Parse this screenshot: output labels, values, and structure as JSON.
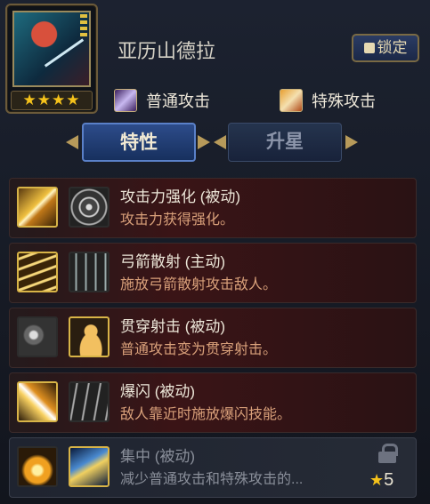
{
  "hero": {
    "name": "亚历山德拉",
    "stars": "★★★★",
    "lock_label": "锁定"
  },
  "attacks": [
    {
      "label": "普通攻击",
      "icon": "feather-icon"
    },
    {
      "label": "特殊攻击",
      "icon": "slash-icon"
    }
  ],
  "tabs": [
    {
      "label": "特性",
      "active": true
    },
    {
      "label": "升星",
      "active": false
    }
  ],
  "skills": [
    {
      "title": "攻击力强化 (被动)",
      "desc": "攻击力获得强化。",
      "locked": false,
      "icons": [
        "swords-icon",
        "target-icon"
      ],
      "active_icon": 0
    },
    {
      "title": "弓箭散射 (主动)",
      "desc": "施放弓箭散射攻击敌人。",
      "locked": false,
      "icons": [
        "arrows-icon",
        "arrow-rain-icon"
      ],
      "active_icon": 0
    },
    {
      "title": "贯穿射击 (被动)",
      "desc": "普通攻击变为贯穿射击。",
      "locked": false,
      "icons": [
        "burst-icon",
        "person-icon"
      ],
      "active_icon": 1
    },
    {
      "title": "爆闪 (被动)",
      "desc": "敌人靠近时施放爆闪技能。",
      "locked": false,
      "icons": [
        "flash-icon",
        "claws-icon"
      ],
      "active_icon": 0
    },
    {
      "title": "集中 (被动)",
      "desc": "减少普通攻击和特殊攻击的...",
      "locked": true,
      "icons": [
        "explode-icon",
        "eye-icon"
      ],
      "active_icon": 1,
      "required_stars": "5"
    }
  ],
  "colors": {
    "accent_gold": "#d8b447",
    "desc_text": "#d9a07a",
    "star": "#f5c21b"
  }
}
